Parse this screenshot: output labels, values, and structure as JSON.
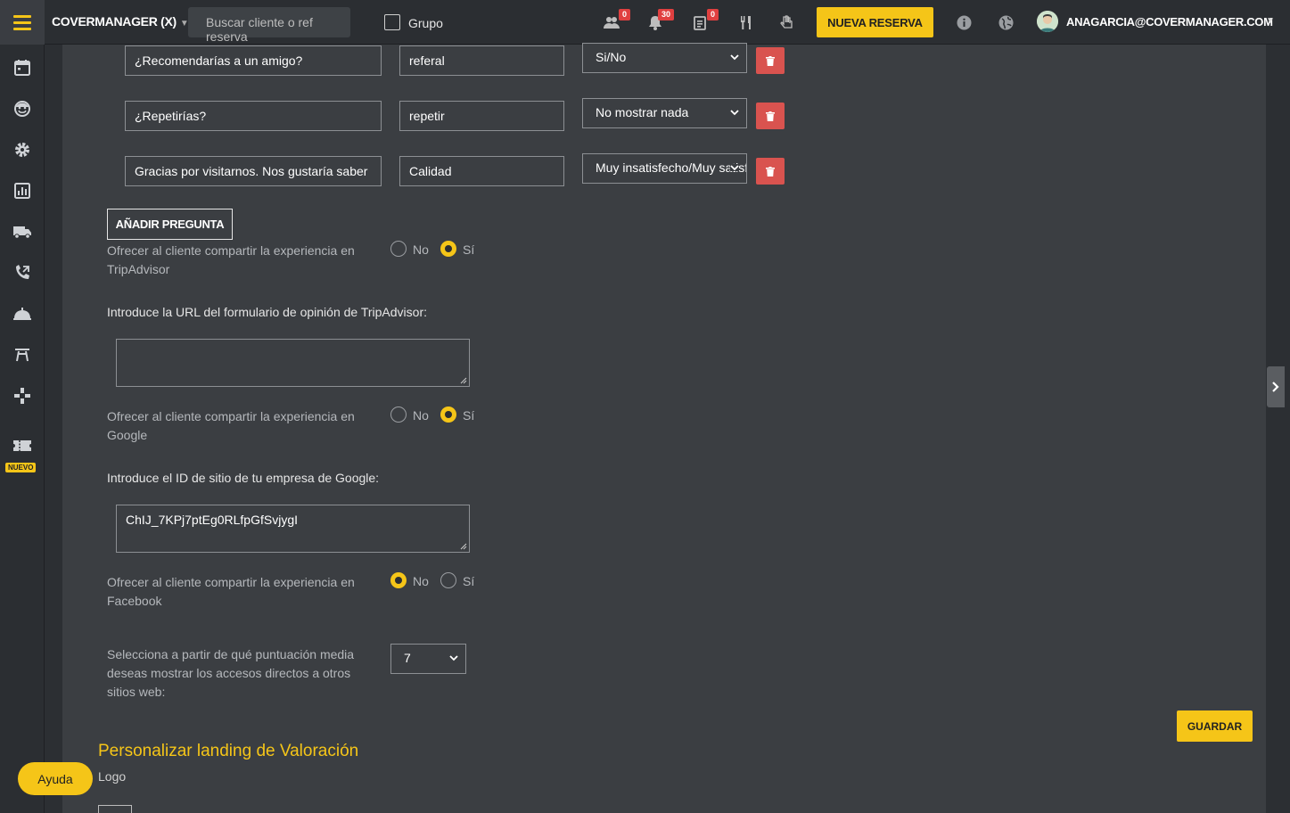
{
  "header": {
    "venue": "COVERMANAGER (X)",
    "search_placeholder": "Buscar cliente o ref reserva",
    "grupo_label": "Grupo",
    "badges": {
      "groups": "0",
      "notifications": "30",
      "tasks": "0"
    },
    "new_reservation_label": "NUEVA RESERVA",
    "user_email": "ANAGARCIA@COVERMANAGER.COM"
  },
  "sidebar": {
    "new_badge": "NUEVO"
  },
  "questions": [
    {
      "question": "¿Recomendarías a un amigo?",
      "key": "referal",
      "type": "Si/No"
    },
    {
      "question": "¿Repetirías?",
      "key": "repetir",
      "type": "No mostrar nada"
    },
    {
      "question": "Gracias por visitarnos. Nos gustaría saber",
      "key": "Calidad",
      "type": "Muy insatisfecho/Muy satisfecho"
    }
  ],
  "add_question_label": "AÑADIR PREGUNTA",
  "options": {
    "tripadvisor": {
      "label": "Ofrecer al cliente compartir la experiencia en TripAdvisor",
      "no": "No",
      "yes": "Sí",
      "selected": "Sí"
    },
    "tripadvisor_url_label": "Introduce la URL del formulario de opinión de TripAdvisor:",
    "tripadvisor_url_value": "",
    "google": {
      "label": "Ofrecer al cliente compartir la experiencia en Google",
      "no": "No",
      "yes": "Sí",
      "selected": "Sí"
    },
    "google_id_label": "Introduce el ID de sitio de tu empresa de Google:",
    "google_id_value": "ChIJ_7KPj7ptEg0RLfpGfSvjygI",
    "facebook": {
      "label": "Ofrecer al cliente compartir la experiencia en Facebook",
      "no": "No",
      "yes": "Sí",
      "selected": "No"
    },
    "score_label": "Selecciona a partir de qué puntuación media deseas mostrar los accesos directos a otros sitios web:",
    "score_value": "7"
  },
  "save_label": "GUARDAR",
  "landing_title": "Personalizar landing de Valoración",
  "logo_label": "Logo",
  "help_label": "Ayuda",
  "colors": {
    "accent": "#f5c518",
    "danger": "#d9534f",
    "panel": "#3b3e42",
    "background": "#2c2f33"
  }
}
